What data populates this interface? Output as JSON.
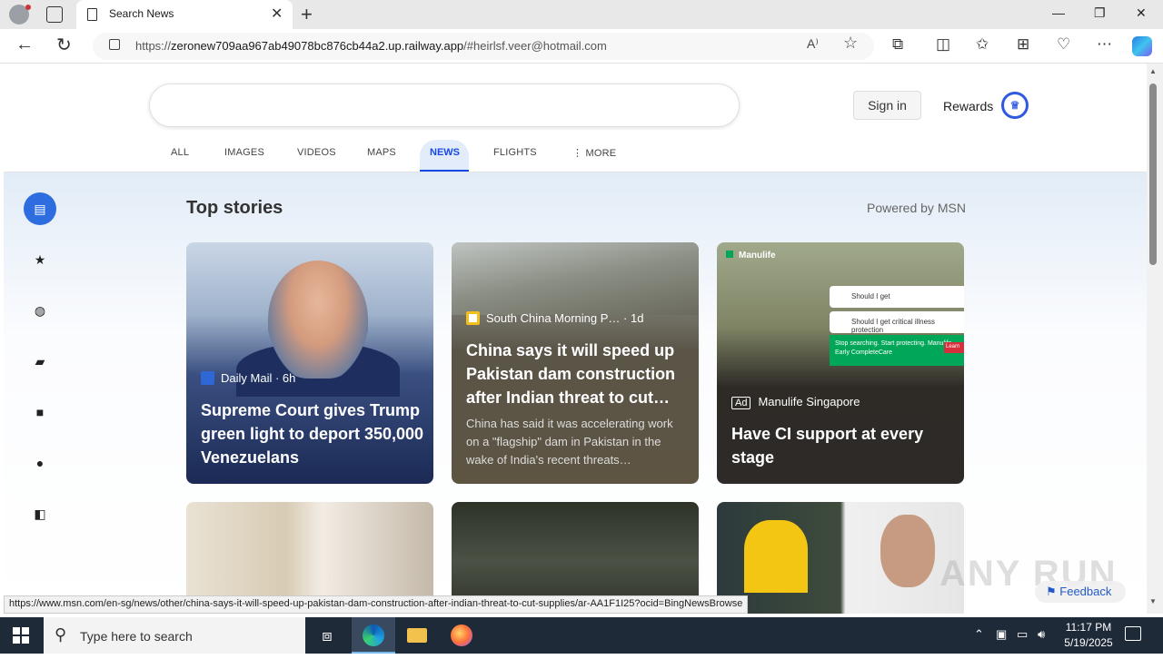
{
  "browser": {
    "tab_title": "Search News",
    "url_prefix": "https://",
    "url_host": "zeronew709aa967ab49078bc876cb44a2.up.railway.app",
    "url_hash": "/#heirlsf.veer@hotmail.com",
    "status_url": "https://www.msn.com/en-sg/news/other/china-says-it-will-speed-up-pakistan-dam-construction-after-indian-threat-to-cut-supplies/ar-AA1F1I25?ocid=BingNewsBrowse",
    "window_controls": {
      "minimize": "—",
      "restore": "❐",
      "close": "✕"
    }
  },
  "header": {
    "signin_label": "Sign in",
    "rewards_label": "Rewards"
  },
  "scopes": {
    "all": "ALL",
    "images": "IMAGES",
    "videos": "VIDEOS",
    "maps": "MAPS",
    "news": "NEWS",
    "flights": "FLIGHTS",
    "more": "⋮ MORE"
  },
  "sidebar": {
    "icons": [
      "news-icon",
      "star-icon",
      "globe-icon",
      "clapperboard-icon",
      "briefcase-icon",
      "sports-ball-icon",
      "tech-icon"
    ]
  },
  "news": {
    "heading": "Top stories",
    "powered_by": "Powered by MSN",
    "cards": [
      {
        "source": "Daily Mail",
        "age": "· 6h",
        "title": "Supreme Court gives Trump green light to deport 350,000 Venezuelans"
      },
      {
        "source": "South China Morning P…",
        "age": "· 1d",
        "title": "China says it will speed up Pakistan dam construction after Indian threat to cut…",
        "description": "China has said it was accelerating work on a \"flagship\" dam in Pakistan in the wake of India's recent threats…"
      },
      {
        "ad_badge": "Ad",
        "source": "Manulife Singapore",
        "title": "Have CI support at every stage",
        "brand": "Manulife",
        "ad_line1": "Should I get",
        "ad_line2": "Should I get critical illness protection",
        "ad_banner": "Stop searching. Start protecting. Manulife Early CompleteCare",
        "ad_cta": "Learn"
      }
    ]
  },
  "feedback_label": "Feedback",
  "watermark": "ANY RUN",
  "taskbar": {
    "search_placeholder": "Type here to search",
    "time": "11:17 PM",
    "date": "5/19/2025"
  },
  "colors": {
    "accent": "#174ae4",
    "taskbar": "#1f2a38"
  }
}
